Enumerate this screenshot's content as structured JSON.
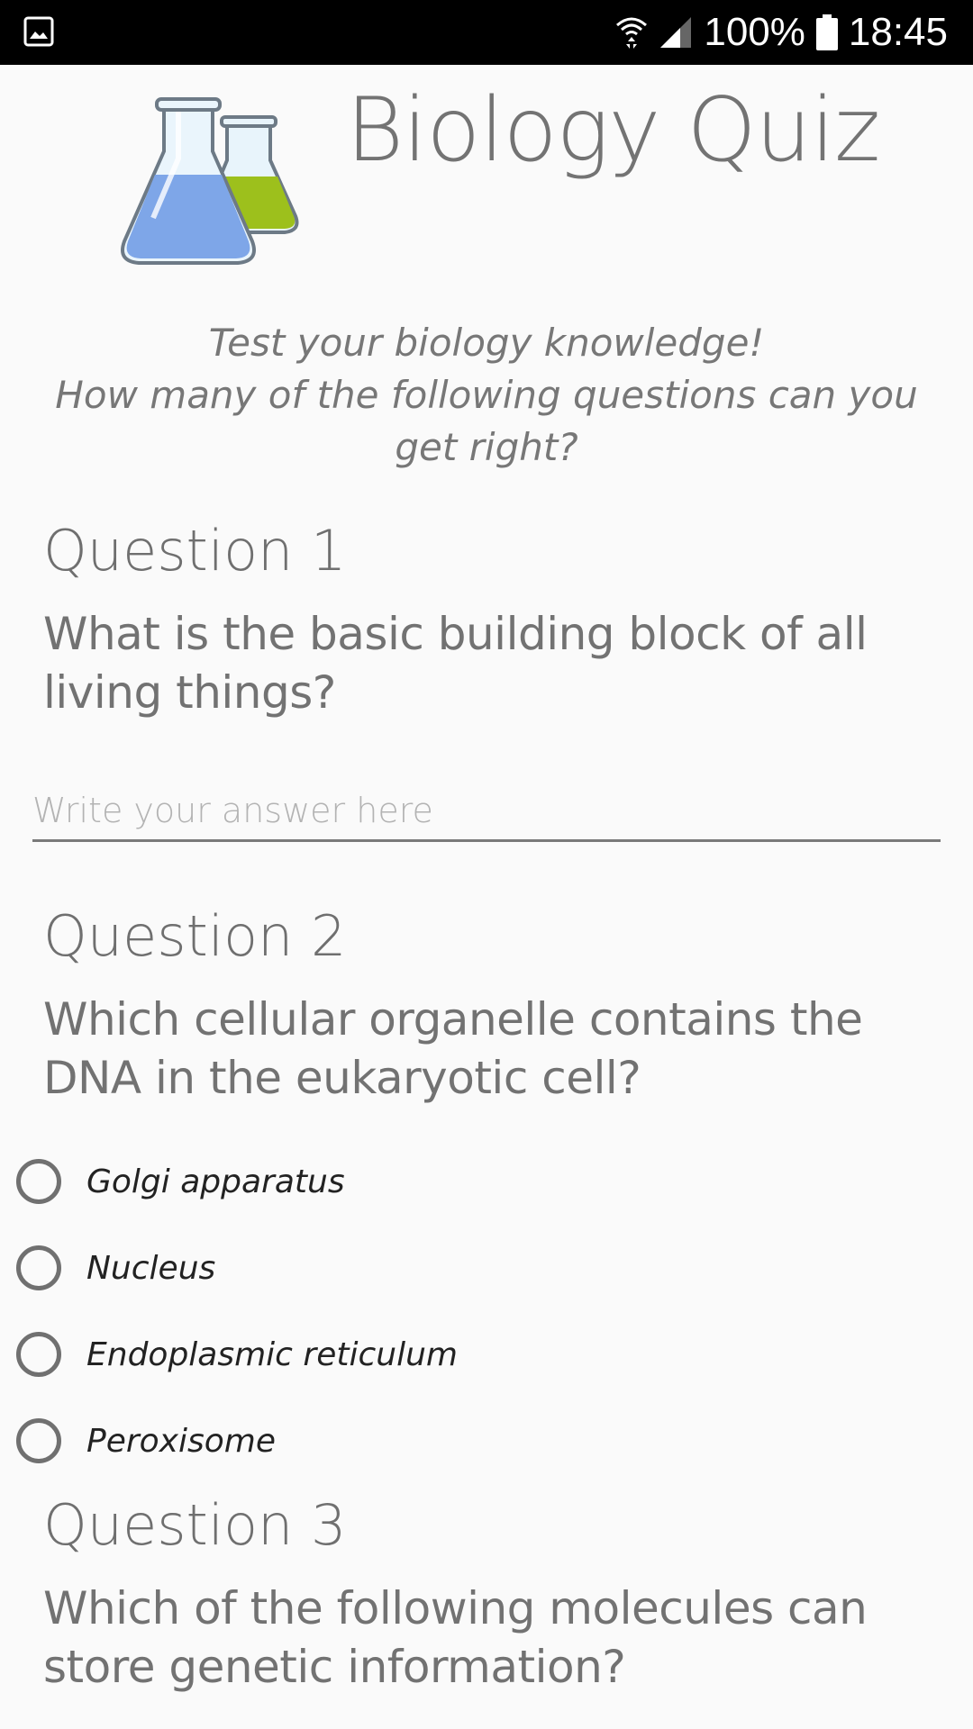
{
  "status_bar": {
    "left_icon": "gallery-icon",
    "wifi_icon": "wifi-icon",
    "signal_icon": "signal-icon",
    "battery_percent": "100%",
    "battery_icon": "battery-icon",
    "time": "18:45"
  },
  "header": {
    "logo_icon": "flask-icon",
    "title": "Biology Quiz"
  },
  "intro": {
    "line1": "Test your biology knowledge!",
    "line2": "How many of the following questions can you get right?"
  },
  "questions": [
    {
      "label": "Question 1",
      "text": "What is the basic building block of all living things?",
      "input_placeholder": "Write your answer here",
      "input_value": ""
    },
    {
      "label": "Question 2",
      "text": "Which cellular organelle contains the DNA in the eukaryotic cell?",
      "options": [
        "Golgi apparatus",
        "Nucleus",
        "Endoplasmic reticulum",
        "Peroxisome"
      ]
    },
    {
      "label": "Question 3",
      "text": "Which of the following molecules can store genetic information?"
    }
  ],
  "colors": {
    "status_bar": "#000000",
    "background": "#fafafa",
    "text": "#737373",
    "flask_blue": "#7ea6e8",
    "flask_green": "#9dc01c"
  }
}
